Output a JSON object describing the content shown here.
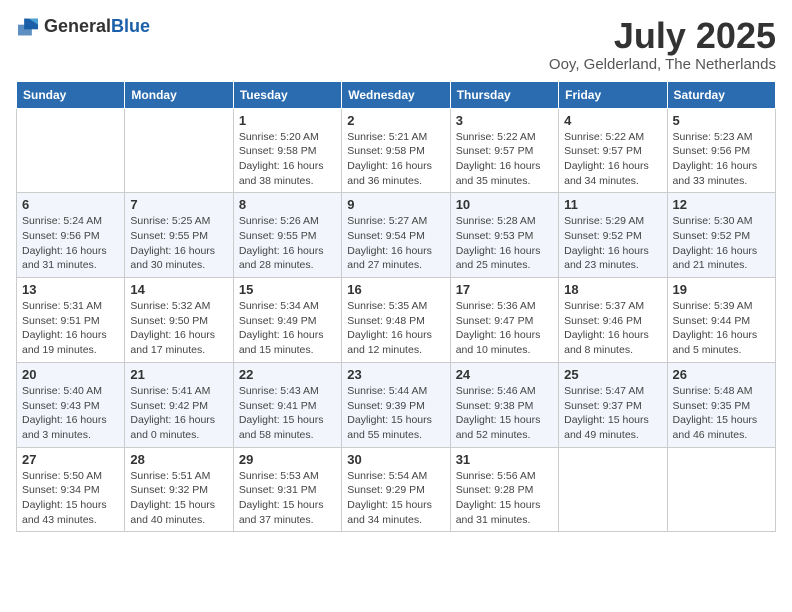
{
  "header": {
    "logo": {
      "general": "General",
      "blue": "Blue"
    },
    "title": "July 2025",
    "location": "Ooy, Gelderland, The Netherlands"
  },
  "days_of_week": [
    "Sunday",
    "Monday",
    "Tuesday",
    "Wednesday",
    "Thursday",
    "Friday",
    "Saturday"
  ],
  "weeks": [
    [
      {
        "day": "",
        "detail": ""
      },
      {
        "day": "",
        "detail": ""
      },
      {
        "day": "1",
        "detail": "Sunrise: 5:20 AM\nSunset: 9:58 PM\nDaylight: 16 hours and 38 minutes."
      },
      {
        "day": "2",
        "detail": "Sunrise: 5:21 AM\nSunset: 9:58 PM\nDaylight: 16 hours and 36 minutes."
      },
      {
        "day": "3",
        "detail": "Sunrise: 5:22 AM\nSunset: 9:57 PM\nDaylight: 16 hours and 35 minutes."
      },
      {
        "day": "4",
        "detail": "Sunrise: 5:22 AM\nSunset: 9:57 PM\nDaylight: 16 hours and 34 minutes."
      },
      {
        "day": "5",
        "detail": "Sunrise: 5:23 AM\nSunset: 9:56 PM\nDaylight: 16 hours and 33 minutes."
      }
    ],
    [
      {
        "day": "6",
        "detail": "Sunrise: 5:24 AM\nSunset: 9:56 PM\nDaylight: 16 hours and 31 minutes."
      },
      {
        "day": "7",
        "detail": "Sunrise: 5:25 AM\nSunset: 9:55 PM\nDaylight: 16 hours and 30 minutes."
      },
      {
        "day": "8",
        "detail": "Sunrise: 5:26 AM\nSunset: 9:55 PM\nDaylight: 16 hours and 28 minutes."
      },
      {
        "day": "9",
        "detail": "Sunrise: 5:27 AM\nSunset: 9:54 PM\nDaylight: 16 hours and 27 minutes."
      },
      {
        "day": "10",
        "detail": "Sunrise: 5:28 AM\nSunset: 9:53 PM\nDaylight: 16 hours and 25 minutes."
      },
      {
        "day": "11",
        "detail": "Sunrise: 5:29 AM\nSunset: 9:52 PM\nDaylight: 16 hours and 23 minutes."
      },
      {
        "day": "12",
        "detail": "Sunrise: 5:30 AM\nSunset: 9:52 PM\nDaylight: 16 hours and 21 minutes."
      }
    ],
    [
      {
        "day": "13",
        "detail": "Sunrise: 5:31 AM\nSunset: 9:51 PM\nDaylight: 16 hours and 19 minutes."
      },
      {
        "day": "14",
        "detail": "Sunrise: 5:32 AM\nSunset: 9:50 PM\nDaylight: 16 hours and 17 minutes."
      },
      {
        "day": "15",
        "detail": "Sunrise: 5:34 AM\nSunset: 9:49 PM\nDaylight: 16 hours and 15 minutes."
      },
      {
        "day": "16",
        "detail": "Sunrise: 5:35 AM\nSunset: 9:48 PM\nDaylight: 16 hours and 12 minutes."
      },
      {
        "day": "17",
        "detail": "Sunrise: 5:36 AM\nSunset: 9:47 PM\nDaylight: 16 hours and 10 minutes."
      },
      {
        "day": "18",
        "detail": "Sunrise: 5:37 AM\nSunset: 9:46 PM\nDaylight: 16 hours and 8 minutes."
      },
      {
        "day": "19",
        "detail": "Sunrise: 5:39 AM\nSunset: 9:44 PM\nDaylight: 16 hours and 5 minutes."
      }
    ],
    [
      {
        "day": "20",
        "detail": "Sunrise: 5:40 AM\nSunset: 9:43 PM\nDaylight: 16 hours and 3 minutes."
      },
      {
        "day": "21",
        "detail": "Sunrise: 5:41 AM\nSunset: 9:42 PM\nDaylight: 16 hours and 0 minutes."
      },
      {
        "day": "22",
        "detail": "Sunrise: 5:43 AM\nSunset: 9:41 PM\nDaylight: 15 hours and 58 minutes."
      },
      {
        "day": "23",
        "detail": "Sunrise: 5:44 AM\nSunset: 9:39 PM\nDaylight: 15 hours and 55 minutes."
      },
      {
        "day": "24",
        "detail": "Sunrise: 5:46 AM\nSunset: 9:38 PM\nDaylight: 15 hours and 52 minutes."
      },
      {
        "day": "25",
        "detail": "Sunrise: 5:47 AM\nSunset: 9:37 PM\nDaylight: 15 hours and 49 minutes."
      },
      {
        "day": "26",
        "detail": "Sunrise: 5:48 AM\nSunset: 9:35 PM\nDaylight: 15 hours and 46 minutes."
      }
    ],
    [
      {
        "day": "27",
        "detail": "Sunrise: 5:50 AM\nSunset: 9:34 PM\nDaylight: 15 hours and 43 minutes."
      },
      {
        "day": "28",
        "detail": "Sunrise: 5:51 AM\nSunset: 9:32 PM\nDaylight: 15 hours and 40 minutes."
      },
      {
        "day": "29",
        "detail": "Sunrise: 5:53 AM\nSunset: 9:31 PM\nDaylight: 15 hours and 37 minutes."
      },
      {
        "day": "30",
        "detail": "Sunrise: 5:54 AM\nSunset: 9:29 PM\nDaylight: 15 hours and 34 minutes."
      },
      {
        "day": "31",
        "detail": "Sunrise: 5:56 AM\nSunset: 9:28 PM\nDaylight: 15 hours and 31 minutes."
      },
      {
        "day": "",
        "detail": ""
      },
      {
        "day": "",
        "detail": ""
      }
    ]
  ]
}
